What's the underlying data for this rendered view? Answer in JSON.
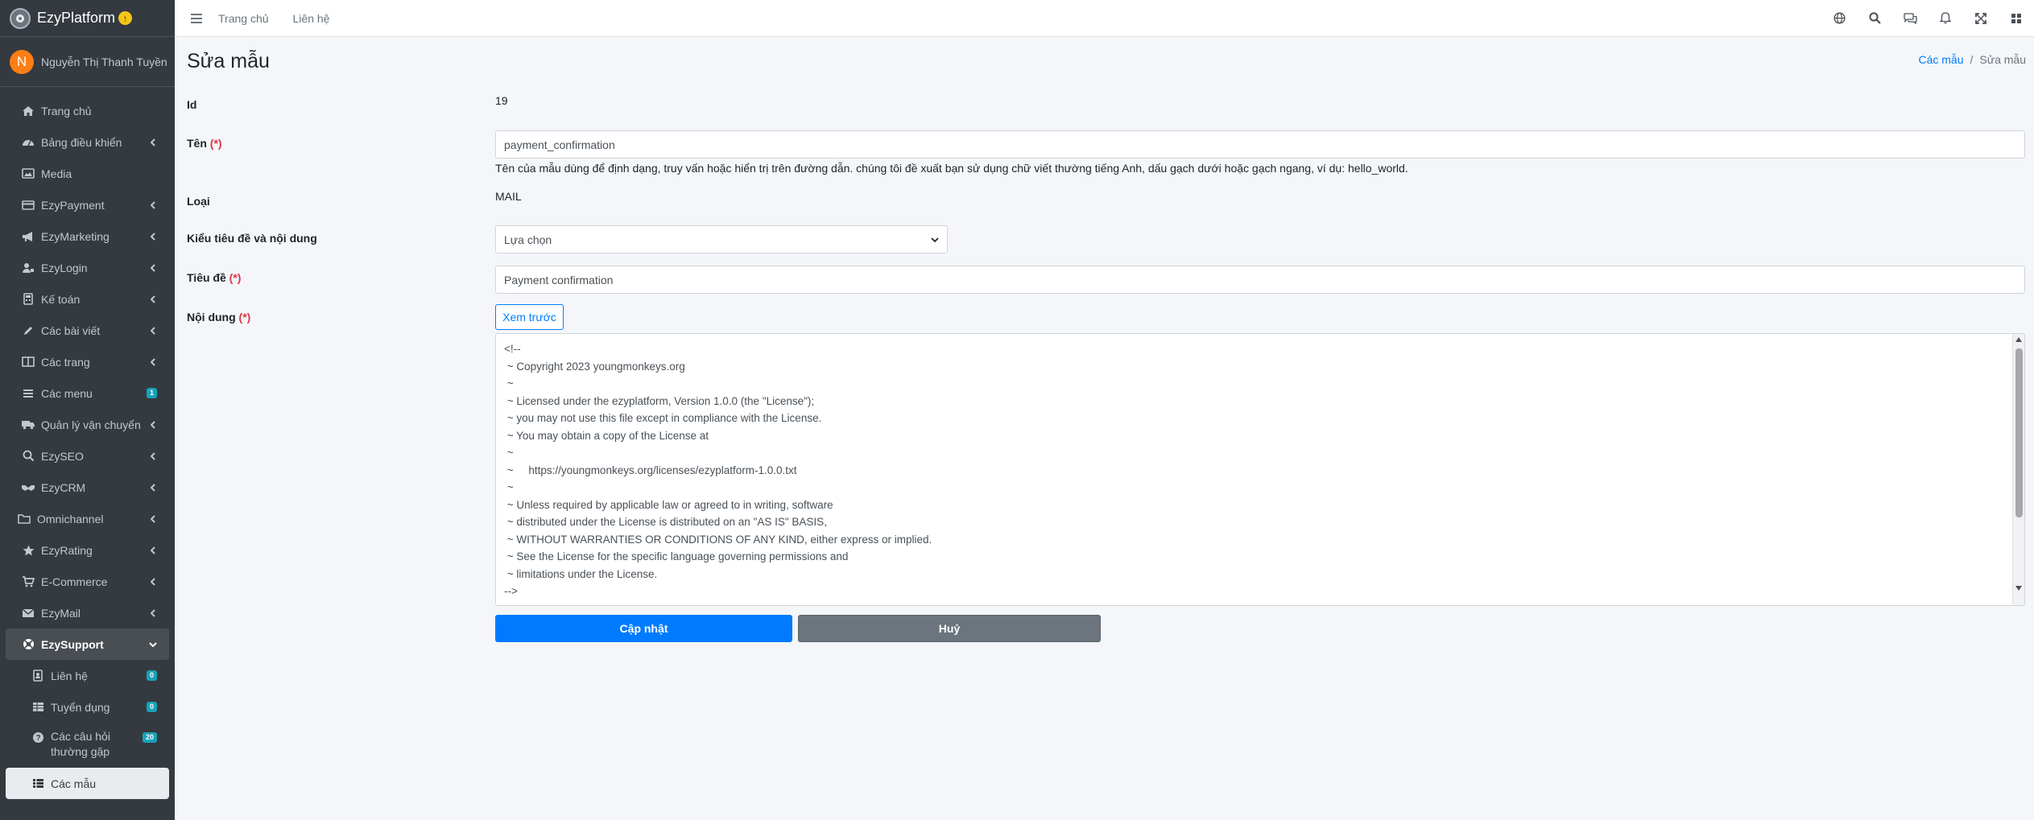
{
  "brand": {
    "name": "EzyPlatform"
  },
  "user": {
    "initial": "N",
    "name": "Nguyễn Thị Thanh Tuyền"
  },
  "sidebar": {
    "items": [
      {
        "label": "Trang chủ",
        "icon": "home-icon"
      },
      {
        "label": "Bảng điều khiển",
        "icon": "dashboard-icon"
      },
      {
        "label": "Media",
        "icon": "image-icon"
      },
      {
        "label": "EzyPayment",
        "icon": "credit-card-icon"
      },
      {
        "label": "EzyMarketing",
        "icon": "megaphone-icon"
      },
      {
        "label": "EzyLogin",
        "icon": "user-lock-icon"
      },
      {
        "label": "Kế toán",
        "icon": "calculator-icon"
      },
      {
        "label": "Các bài viết",
        "icon": "pen-icon"
      },
      {
        "label": "Các trang",
        "icon": "columns-icon"
      },
      {
        "label": "Các menu",
        "icon": "bars-icon",
        "badge": "1"
      },
      {
        "label": "Quản lý vận chuyển",
        "icon": "truck-icon"
      },
      {
        "label": "EzySEO",
        "icon": "search-plus-icon"
      },
      {
        "label": "EzyCRM",
        "icon": "handshake-icon"
      },
      {
        "label": "Omnichannel",
        "icon": "folder-icon"
      },
      {
        "label": "EzyRating",
        "icon": "star-icon"
      },
      {
        "label": "E-Commerce",
        "icon": "shopping-cart-icon"
      },
      {
        "label": "EzyMail",
        "icon": "envelope-icon"
      },
      {
        "label": "EzySupport",
        "icon": "support-icon"
      }
    ],
    "sub_items": [
      {
        "label": "Liên hệ",
        "icon": "address-book-icon",
        "badge": "0"
      },
      {
        "label": "Tuyển dụng",
        "icon": "table-icon",
        "badge": "0"
      },
      {
        "label": "Các câu hỏi thường gặp",
        "icon": "question-circle-icon",
        "badge": "20"
      },
      {
        "label": "Các mẫu",
        "icon": "list-icon"
      }
    ]
  },
  "topbar": {
    "home": "Trang chủ",
    "contact": "Liên hệ"
  },
  "page": {
    "title": "Sửa mẫu",
    "breadcrumb": {
      "parent": "Các mẫu",
      "sep": "/",
      "current": "Sửa mẫu"
    }
  },
  "form": {
    "id_label": "Id",
    "id_value": "19",
    "name_label": "Tên",
    "required_mark": "(*)",
    "name_value": "payment_confirmation",
    "name_help": "Tên của mẫu dùng để định dạng, truy vấn hoặc hiển trị trên đường dẫn. chúng tôi đề xuất bạn sử dụng chữ viết thường tiếng Anh, dấu gạch dưới hoặc gạch ngang, ví dụ: hello_world.",
    "type_label": "Loại",
    "type_value": "MAIL",
    "style_label": "Kiểu tiêu đề và nội dung",
    "style_value": "Lựa chọn",
    "subject_label": "Tiêu đề",
    "subject_value": "Payment confirmation",
    "content_label": "Nội dung",
    "preview_button": "Xem trước",
    "content_text": "<!--\n ~ Copyright 2023 youngmonkeys.org\n ~\n ~ Licensed under the ezyplatform, Version 1.0.0 (the \"License\");\n ~ you may not use this file except in compliance with the License.\n ~ You may obtain a copy of the License at\n ~\n ~     https://youngmonkeys.org/licenses/ezyplatform-1.0.0.txt\n ~\n ~ Unless required by applicable law or agreed to in writing, software\n ~ distributed under the License is distributed on an \"AS IS\" BASIS,\n ~ WITHOUT WARRANTIES OR CONDITIONS OF ANY KIND, either express or implied.\n ~ See the License for the specific language governing permissions and\n ~ limitations under the License.\n-->",
    "update_button": "Cập nhật",
    "cancel_button": "Huỷ"
  },
  "colors": {
    "primary": "#007bff",
    "sidebar": "#343a40",
    "secondary": "#6c757d",
    "required": "#dc3545",
    "badge": "#17a2b8"
  }
}
